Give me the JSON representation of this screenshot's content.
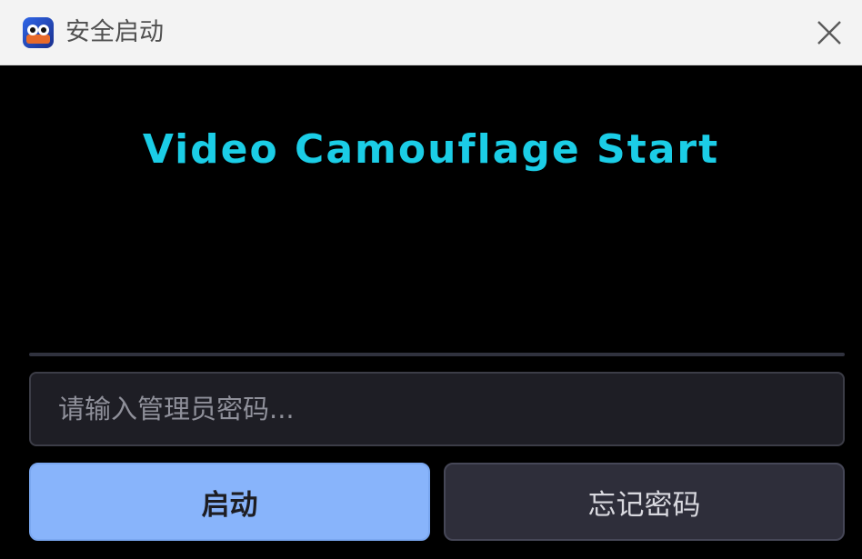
{
  "window": {
    "title": "安全启动",
    "icon": "app-logo-icon",
    "close_icon": "close-icon"
  },
  "main": {
    "headline": "Video Camouflage Start",
    "password_placeholder": "请输入管理员密码...",
    "password_value": "",
    "start_label": "启动",
    "forgot_label": "忘记密码"
  },
  "colors": {
    "headline": "#1bcde6",
    "start_button": "#88b4fb",
    "forgot_button": "#2e2e3a",
    "input_bg": "#1e1e25",
    "titlebar": "#f3f3f3"
  }
}
